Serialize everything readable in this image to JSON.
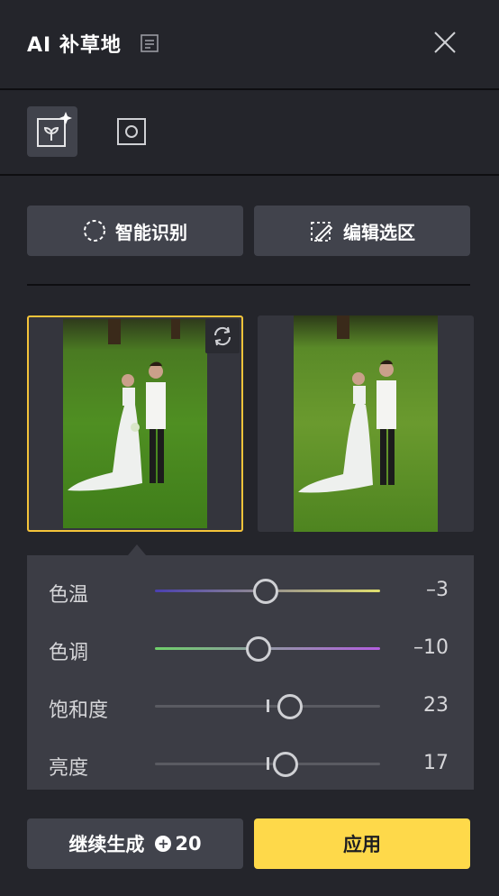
{
  "header": {
    "title": "AI 补草地"
  },
  "tools": [
    {
      "name": "grass-tool",
      "active": true
    },
    {
      "name": "frame-tool",
      "active": false
    }
  ],
  "actions": {
    "smart_detect": "智能识别",
    "edit_selection": "编辑选区"
  },
  "thumbnails": [
    {
      "selected": true
    },
    {
      "selected": false
    }
  ],
  "adjustments": [
    {
      "label": "色温",
      "value": "–3",
      "level": 0.49,
      "gradient": [
        "#4a3fb0",
        "#e0df6e"
      ]
    },
    {
      "label": "色调",
      "value": "–10",
      "level": 0.46,
      "gradient": [
        "#6fd06a",
        "#b35ee0"
      ]
    },
    {
      "label": "饱和度",
      "value": "23",
      "level": 0.6,
      "gradient": [
        "#5a5b62",
        "#5a5b62"
      ]
    },
    {
      "label": "亮度",
      "value": "17",
      "level": 0.58,
      "gradient": [
        "#5a5b62",
        "#5a5b62"
      ]
    }
  ],
  "footer": {
    "generate_label": "继续生成",
    "cost": "20",
    "apply_label": "应用"
  },
  "colors": {
    "accent": "#fed94a",
    "selection_border": "#f5c43a"
  }
}
